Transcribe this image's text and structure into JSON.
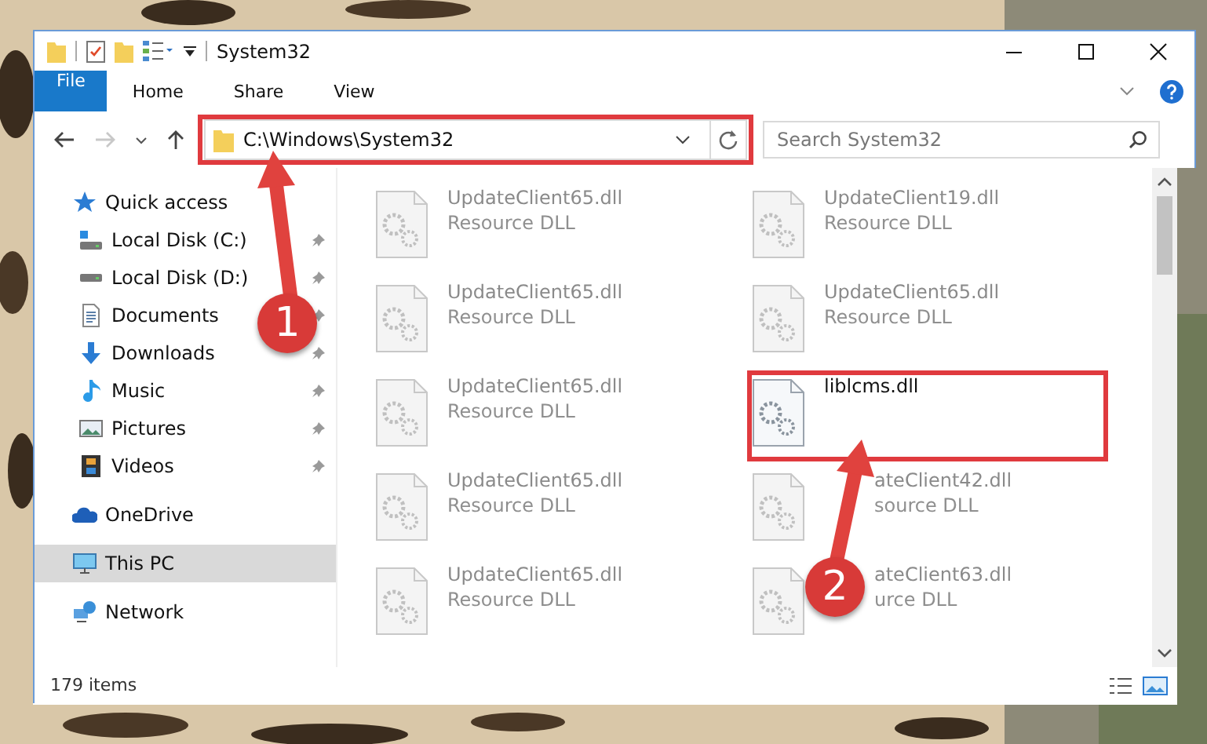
{
  "window": {
    "title": "System32"
  },
  "ribbon": {
    "tabs": [
      {
        "label": "File",
        "kind": "file"
      },
      {
        "label": "Home",
        "kind": "tab"
      },
      {
        "label": "Share",
        "kind": "tab"
      },
      {
        "label": "View",
        "kind": "tab"
      }
    ]
  },
  "navigation": {
    "back": {
      "disabled": false
    },
    "forward": {
      "disabled": true
    }
  },
  "address": {
    "path": "C:\\Windows\\System32"
  },
  "search": {
    "placeholder": "Search System32"
  },
  "sidebar": {
    "items": [
      {
        "label": "Quick access",
        "kind": "star",
        "selected": false,
        "children": [
          {
            "label": "Local Disk (C:)",
            "kind": "windrive",
            "pinned": true,
            "selected": false
          },
          {
            "label": "Local Disk (D:)",
            "kind": "drive",
            "pinned": true,
            "selected": false
          },
          {
            "label": "Documents",
            "kind": "document",
            "pinned": true,
            "selected": false
          },
          {
            "label": "Downloads",
            "kind": "download",
            "pinned": true,
            "selected": false
          },
          {
            "label": "Music",
            "kind": "music",
            "pinned": true,
            "selected": false
          },
          {
            "label": "Pictures",
            "kind": "pictures",
            "pinned": true,
            "selected": false
          },
          {
            "label": "Videos",
            "kind": "videos",
            "pinned": true,
            "selected": false
          }
        ]
      },
      {
        "label": "OneDrive",
        "kind": "cloud",
        "selected": false
      },
      {
        "label": "This PC",
        "kind": "pc",
        "selected": true
      },
      {
        "label": "Network",
        "kind": "network",
        "selected": false
      }
    ]
  },
  "files": [
    {
      "name": "UpdateClient65.dll",
      "type": "Resource DLL",
      "blurred": true,
      "covered": false
    },
    {
      "name": "UpdateClient19.dll",
      "type": "Resource DLL",
      "blurred": true,
      "covered": false
    },
    {
      "name": "UpdateClient65.dll",
      "type": "Resource DLL",
      "blurred": true,
      "covered": false
    },
    {
      "name": "UpdateClient65.dll",
      "type": "Resource DLL",
      "blurred": true,
      "covered": false
    },
    {
      "name": "UpdateClient65.dll",
      "type": "Resource DLL",
      "blurred": true,
      "covered": false
    },
    {
      "name": "liblcms.dll",
      "blurred": false
    },
    {
      "name": "UpdateClient65.dll",
      "type": "Resource DLL",
      "blurred": true,
      "covered": false
    },
    {
      "name": "ateClient42.dll",
      "type": "source DLL",
      "blurred": true,
      "covered": true
    },
    {
      "name": "UpdateClient65.dll",
      "type": "Resource DLL",
      "blurred": true,
      "covered": false
    },
    {
      "name": "ateClient63.dll",
      "type": "urce DLL",
      "blurred": true,
      "covered": true
    }
  ],
  "status_bar": {
    "count": "179 items"
  },
  "annotations": [
    {
      "number": "1"
    },
    {
      "number": "2"
    }
  ]
}
